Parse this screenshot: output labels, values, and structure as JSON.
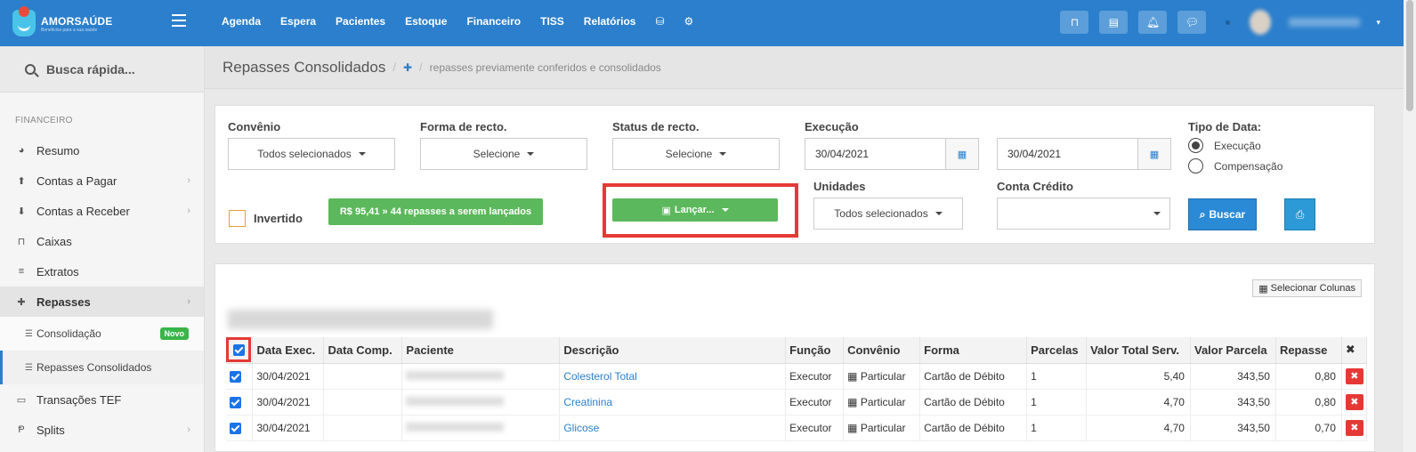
{
  "brand": {
    "name": "AMORSAÚDE",
    "tagline": "Beneficios para a sua saúde"
  },
  "nav": [
    "Agenda",
    "Espera",
    "Pacientes",
    "Estoque",
    "Financeiro",
    "TISS",
    "Relatórios"
  ],
  "sidebar": {
    "search_placeholder": "Busca rápida...",
    "section": "FINANCEIRO",
    "items": [
      {
        "label": "Resumo",
        "icon": "pie-chart-icon"
      },
      {
        "label": "Contas a Pagar",
        "icon": "arrow-up-circle-icon"
      },
      {
        "label": "Contas a Receber",
        "icon": "arrow-down-circle-icon"
      },
      {
        "label": "Caixas",
        "icon": "inbox-icon"
      },
      {
        "label": "Extratos",
        "icon": "list-icon"
      },
      {
        "label": "Repasses",
        "icon": "puzzle-icon"
      }
    ],
    "sub_items": [
      {
        "label": "Consolidação",
        "badge": "Novo"
      },
      {
        "label": "Repasses Consolidados"
      }
    ],
    "items_after": [
      {
        "label": "Transações TEF",
        "icon": "credit-card-icon"
      },
      {
        "label": "Splits",
        "icon": "split-icon"
      }
    ]
  },
  "page": {
    "title": "Repasses Consolidados",
    "breadcrumb": "repasses previamente conferidos e consolidados"
  },
  "filters": {
    "convenio": {
      "label": "Convênio",
      "value": "Todos selecionados"
    },
    "forma": {
      "label": "Forma de recto.",
      "value": "Selecione"
    },
    "status": {
      "label": "Status de recto.",
      "value": "Selecione"
    },
    "execucao": {
      "label": "Execução",
      "from": "30/04/2021",
      "to": "30/04/2021"
    },
    "tipo_data": {
      "label": "Tipo de Data:",
      "options": [
        "Execução",
        "Compensação"
      ],
      "selected": "Execução"
    },
    "invertido": "Invertido",
    "summary": "R$ 95,41 » 44 repasses a serem lançados",
    "lancar": "Lançar...",
    "unidades": {
      "label": "Unidades",
      "value": "Todos selecionados"
    },
    "conta_credito": {
      "label": "Conta Crédito",
      "value": ""
    },
    "buscar": "Buscar"
  },
  "results": {
    "select_columns": "Selecionar Colunas",
    "columns": [
      "Data Exec.",
      "Data Comp.",
      "Paciente",
      "Descrição",
      "Função",
      "Convênio",
      "Forma",
      "Parcelas",
      "Valor Total Serv.",
      "Valor Parcela",
      "Repasse"
    ],
    "rows": [
      {
        "data_exec": "30/04/2021",
        "descricao": "Colesterol Total",
        "funcao": "Executor",
        "convenio": "Particular",
        "forma": "Cartão de Débito",
        "parcelas": "1",
        "valor_total": "5,40",
        "valor_parcela": "343,50",
        "repasse": "0,80"
      },
      {
        "data_exec": "30/04/2021",
        "descricao": "Creatinina",
        "funcao": "Executor",
        "convenio": "Particular",
        "forma": "Cartão de Débito",
        "parcelas": "1",
        "valor_total": "4,70",
        "valor_parcela": "343,50",
        "repasse": "0,80"
      },
      {
        "data_exec": "30/04/2021",
        "descricao": "Glicose",
        "funcao": "Executor",
        "convenio": "Particular",
        "forma": "Cartão de Débito",
        "parcelas": "1",
        "valor_total": "4,70",
        "valor_parcela": "343,50",
        "repasse": "0,70"
      }
    ]
  },
  "colors": {
    "primary": "#2b7fcc",
    "success": "#5cb85c",
    "highlight": "#e53935"
  }
}
